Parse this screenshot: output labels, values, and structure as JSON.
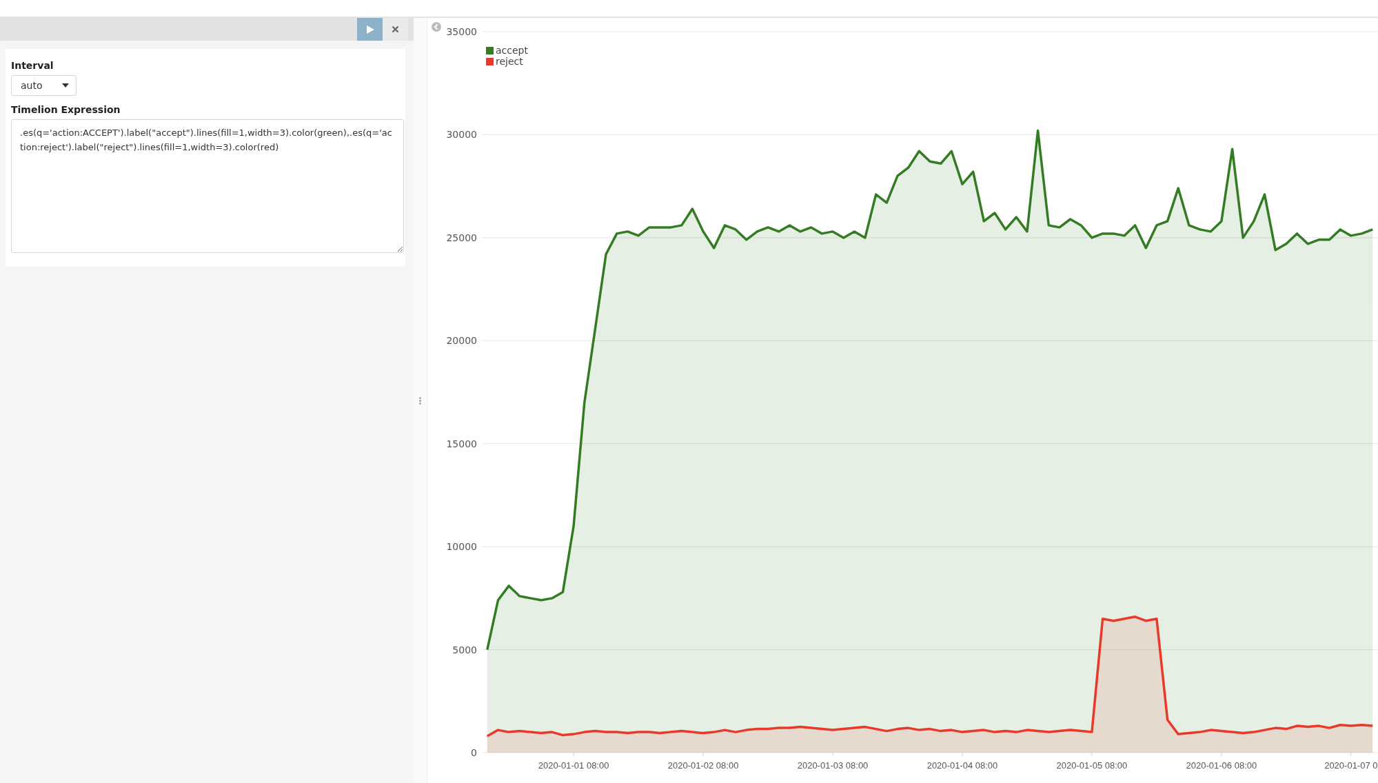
{
  "editor": {
    "run_button": {
      "disabled": false
    },
    "interval": {
      "label": "Interval",
      "value": "auto"
    },
    "expression": {
      "label": "Timelion Expression",
      "value": ".es(q='action:ACCEPT').label(\"accept\").lines(fill=1,width=3).color(green),.es(q='action:reject').label(\"reject\").lines(fill=1,width=3).color(red)"
    }
  },
  "panel": {
    "chart_data": {
      "type": "area",
      "grid": true,
      "legend": "top-left",
      "ylim": [
        0,
        35000
      ],
      "yticks": [
        0,
        5000,
        10000,
        15000,
        20000,
        25000,
        30000,
        35000
      ],
      "categories": [
        null,
        null,
        null,
        null,
        null,
        null,
        null,
        null,
        "2020-01-01 08:00",
        null,
        null,
        null,
        null,
        null,
        null,
        null,
        null,
        null,
        null,
        null,
        "2020-01-02 08:00",
        null,
        null,
        null,
        null,
        null,
        null,
        null,
        null,
        null,
        null,
        null,
        "2020-01-03 08:00",
        null,
        null,
        null,
        null,
        null,
        null,
        null,
        null,
        null,
        null,
        null,
        "2020-01-04 08:00",
        null,
        null,
        null,
        null,
        null,
        null,
        null,
        null,
        null,
        null,
        null,
        "2020-01-05 08:00",
        null,
        null,
        null,
        null,
        null,
        null,
        null,
        null,
        null,
        null,
        null,
        "2020-01-06 08:00",
        null,
        null,
        null,
        null,
        null,
        null,
        null,
        null,
        null,
        null,
        null,
        "2020-01-07 0",
        null,
        null
      ],
      "series": [
        {
          "name": "accept",
          "color": "#347c24",
          "values": [
            5000,
            7400,
            8100,
            7600,
            7500,
            7400,
            7500,
            7800,
            11000,
            17000,
            20600,
            24200,
            25200,
            25300,
            25100,
            25500,
            25500,
            25500,
            25600,
            26400,
            25300,
            24500,
            25600,
            25400,
            24900,
            25300,
            25500,
            25300,
            25600,
            25300,
            25500,
            25200,
            25300,
            25000,
            25300,
            25000,
            27100,
            26700,
            28000,
            28400,
            29200,
            28700,
            28600,
            29200,
            27600,
            28200,
            25800,
            26200,
            25400,
            26000,
            25300,
            30200,
            25600,
            25500,
            25900,
            25600,
            25000,
            25200,
            25200,
            25100,
            25600,
            24500,
            25600,
            25800,
            27400,
            25600,
            25400,
            25300,
            25800,
            29300,
            25000,
            25800,
            27100,
            24400,
            24700,
            25200,
            24700,
            24900,
            24900,
            25400,
            25100,
            25200,
            25400
          ]
        },
        {
          "name": "reject",
          "color": "#e8392b",
          "values": [
            800,
            1100,
            1000,
            1050,
            1000,
            950,
            1000,
            850,
            900,
            1000,
            1050,
            1000,
            1000,
            950,
            1000,
            1000,
            950,
            1000,
            1050,
            1000,
            950,
            1000,
            1100,
            1000,
            1100,
            1150,
            1150,
            1200,
            1200,
            1250,
            1200,
            1150,
            1100,
            1150,
            1200,
            1250,
            1150,
            1050,
            1150,
            1200,
            1100,
            1150,
            1050,
            1100,
            1000,
            1050,
            1100,
            1000,
            1050,
            1000,
            1100,
            1050,
            1000,
            1050,
            1100,
            1050,
            1000,
            6500,
            6400,
            6500,
            6600,
            6400,
            6500,
            1600,
            900,
            950,
            1000,
            1100,
            1050,
            1000,
            950,
            1000,
            1100,
            1200,
            1150,
            1300,
            1250,
            1300,
            1200,
            1350,
            1300,
            1350,
            1300
          ]
        }
      ]
    }
  }
}
